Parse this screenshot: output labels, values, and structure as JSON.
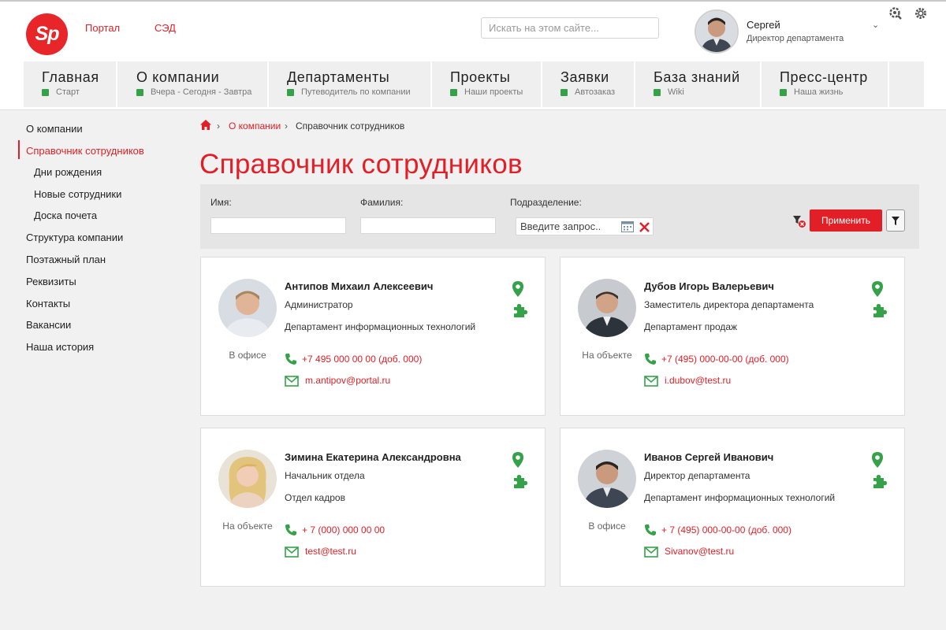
{
  "header": {
    "logo_text": "Sp",
    "links": [
      "Портал",
      "СЭД"
    ],
    "search_placeholder": "Искать на этом сайте...",
    "user": {
      "name": "Сергей",
      "role": "Директор департамента"
    }
  },
  "nav": [
    {
      "title": "Главная",
      "sub": "Старт"
    },
    {
      "title": "О компании",
      "sub": "Вчера - Сегодня - Завтра"
    },
    {
      "title": "Департаменты",
      "sub": "Путеводитель по компании"
    },
    {
      "title": "Проекты",
      "sub": "Наши проекты"
    },
    {
      "title": "Заявки",
      "sub": "Автозаказ"
    },
    {
      "title": "База знаний",
      "sub": "Wiki"
    },
    {
      "title": "Пресс-центр",
      "sub": "Наша жизнь"
    }
  ],
  "sidebar": [
    {
      "label": "О компании",
      "active": false,
      "level": 0
    },
    {
      "label": "Справочник сотрудников",
      "active": true,
      "level": 0
    },
    {
      "label": "Дни рождения",
      "active": false,
      "level": 1
    },
    {
      "label": "Новые сотрудники",
      "active": false,
      "level": 1
    },
    {
      "label": "Доска почета",
      "active": false,
      "level": 1
    },
    {
      "label": "Структура компании",
      "active": false,
      "level": 0
    },
    {
      "label": "Поэтажный план",
      "active": false,
      "level": 0
    },
    {
      "label": "Реквизиты",
      "active": false,
      "level": 0
    },
    {
      "label": "Контакты",
      "active": false,
      "level": 0
    },
    {
      "label": "Вакансии",
      "active": false,
      "level": 0
    },
    {
      "label": "Наша история",
      "active": false,
      "level": 0
    }
  ],
  "breadcrumb": {
    "parent": "О компании",
    "current": "Справочник сотрудников"
  },
  "page_title": "Справочник сотрудников",
  "filter": {
    "first_name_label": "Имя:",
    "first_name_value": "",
    "last_name_label": "Фамилия:",
    "last_name_value": "",
    "department_label": "Подразделение:",
    "department_placeholder": "Введите запрос..",
    "apply_label": "Применить"
  },
  "employees": [
    {
      "name": "Антипов Михаил Алексеевич",
      "position": "Администратор",
      "department": "Департамент информационных технологий",
      "status": "В офисе",
      "phone": "+7 495 000 00 00 (доб. 000)",
      "email": "m.antipov@portal.ru"
    },
    {
      "name": "Дубов Игорь Валерьевич",
      "position": "Заместитель директора департамента",
      "department": "Департамент продаж",
      "status": "На объекте",
      "phone": "+7 (495) 000-00-00 (доб. 000)",
      "email": "i.dubov@test.ru"
    },
    {
      "name": "Зимина Екатерина Александровна",
      "position": "Начальник отдела",
      "department": "Отдел кадров",
      "status": "На объекте",
      "phone": "+ 7 (000) 000 00 00",
      "email": "test@test.ru"
    },
    {
      "name": "Иванов Сергей Иванович",
      "position": "Директор департамента",
      "department": "Департамент информационных технологий",
      "status": "В офисе",
      "phone": "+ 7 (495) 000-00-00 (доб. 000)",
      "email": "Sivanov@test.ru"
    }
  ],
  "colors": {
    "brand": "#e21f26",
    "accent_green": "#35a24a",
    "background": "#f1f1f1"
  },
  "icons": [
    "search-icon",
    "settings-icon",
    "gear-icon",
    "home-icon",
    "map-pin-icon",
    "puzzle-icon",
    "phone-icon",
    "mail-icon",
    "funnel-icon",
    "clear-filter-icon",
    "calendar-icon",
    "close-icon",
    "chevron-down-icon"
  ]
}
